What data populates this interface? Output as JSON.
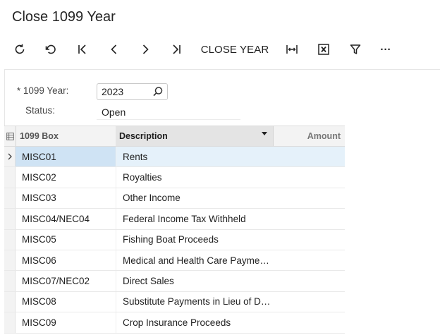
{
  "page": {
    "title": "Close 1099 Year"
  },
  "toolbar": {
    "close_year_label": "CLOSE YEAR",
    "more_label": "···"
  },
  "form": {
    "year_label": "1099 Year:",
    "required_mark": "*",
    "year_value": "2023",
    "status_label": "Status:",
    "status_value": "Open"
  },
  "grid": {
    "columns": {
      "box": "1099 Box",
      "description": "Description",
      "amount": "Amount"
    },
    "rows": [
      {
        "box": "MISC01",
        "description": "Rents",
        "amount": ""
      },
      {
        "box": "MISC02",
        "description": "Royalties",
        "amount": ""
      },
      {
        "box": "MISC03",
        "description": "Other Income",
        "amount": ""
      },
      {
        "box": "MISC04/NEC04",
        "description": "Federal Income Tax Withheld",
        "amount": ""
      },
      {
        "box": "MISC05",
        "description": "Fishing Boat Proceeds",
        "amount": ""
      },
      {
        "box": "MISC06",
        "description": "Medical and Health Care Payme…",
        "amount": ""
      },
      {
        "box": "MISC07/NEC02",
        "description": "Direct Sales",
        "amount": ""
      },
      {
        "box": "MISC08",
        "description": "Substitute Payments in Lieu of D…",
        "amount": ""
      },
      {
        "box": "MISC09",
        "description": "Crop Insurance Proceeds",
        "amount": ""
      }
    ]
  }
}
